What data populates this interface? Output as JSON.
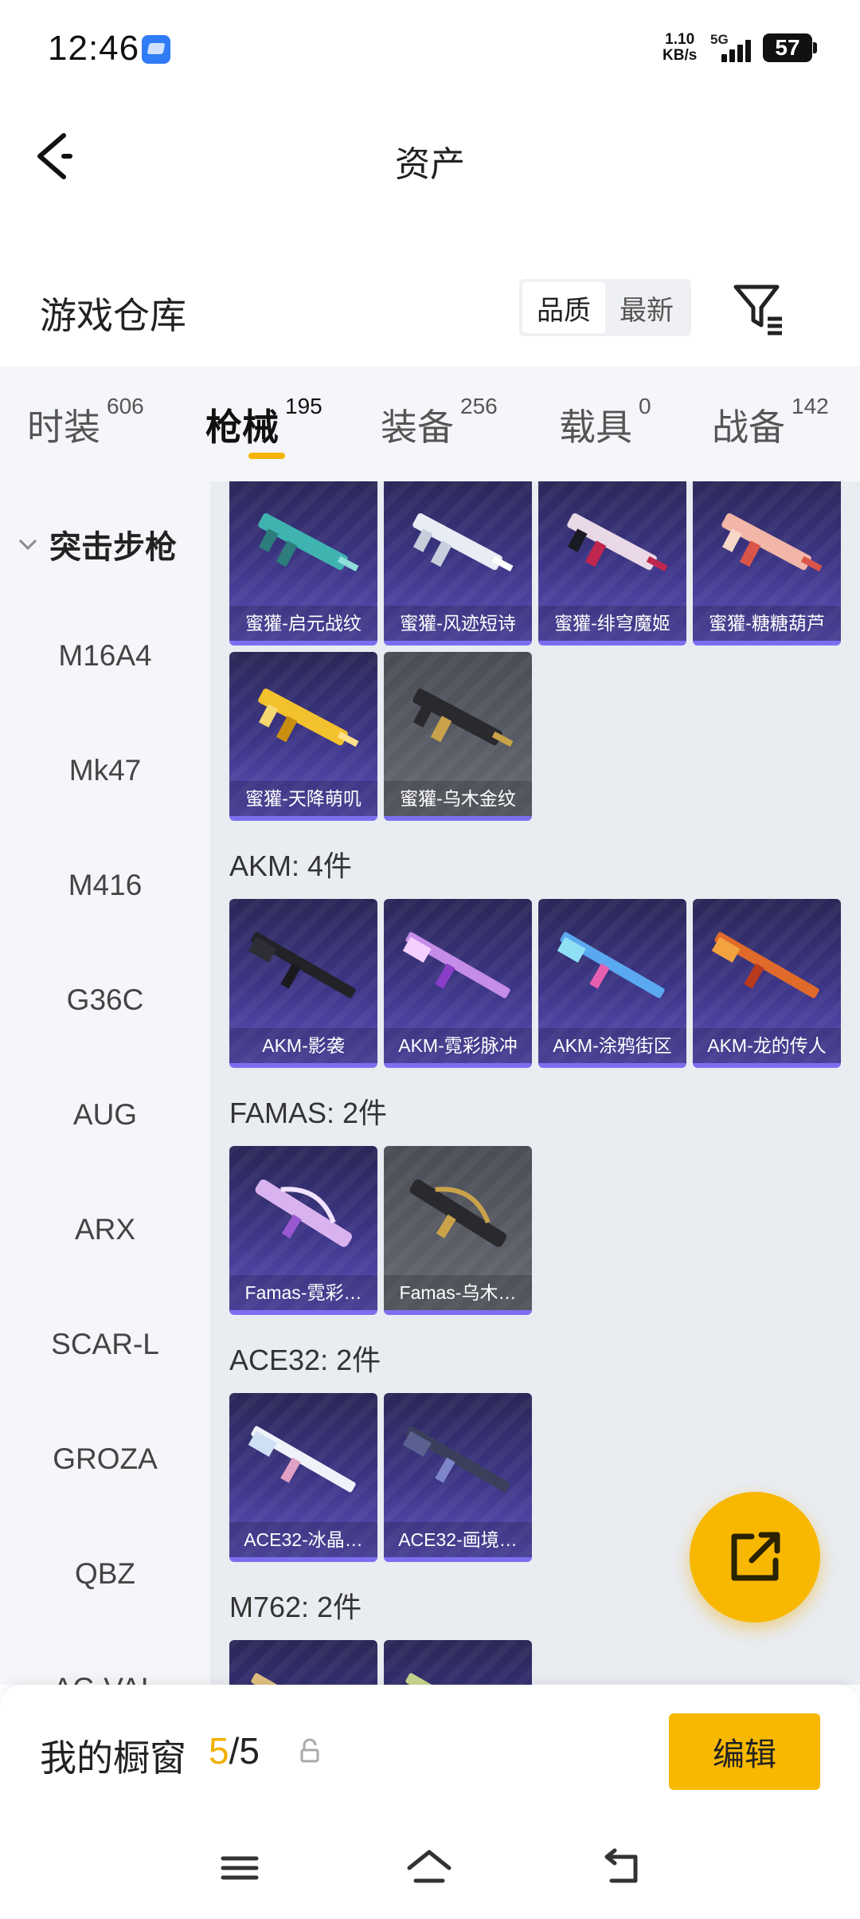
{
  "status": {
    "time": "12:46",
    "net_speed_value": "1.10",
    "net_speed_unit": "KB/s",
    "network": "5G",
    "battery": "57"
  },
  "header": {
    "title": "资产"
  },
  "warehouse": {
    "title": "游戏仓库",
    "sort_options": [
      "品质",
      "最新"
    ],
    "active_sort": "品质"
  },
  "tabs": [
    {
      "label": "时装",
      "count": "606"
    },
    {
      "label": "枪械",
      "count": "195"
    },
    {
      "label": "装备",
      "count": "256"
    },
    {
      "label": "载具",
      "count": "0"
    },
    {
      "label": "战备",
      "count": "142"
    }
  ],
  "sidebar": {
    "category": "突击步枪",
    "items": [
      "M16A4",
      "Mk47",
      "M416",
      "G36C",
      "AUG",
      "ARX",
      "SCAR-L",
      "GROZA",
      "QBZ",
      "AC-VAL"
    ]
  },
  "groups": [
    {
      "label": "",
      "items": [
        "蜜獾-启元战纹",
        "蜜獾-风迹短诗",
        "蜜獾-绯穹魔姬",
        "蜜獾-糖糖葫芦",
        "蜜獾-天降萌叽",
        "蜜獾-乌木金纹"
      ]
    },
    {
      "label": "AKM: 4件",
      "items": [
        "AKM-影袭",
        "AKM-霓彩脉冲",
        "AKM-涂鸦街区",
        "AKM-龙的传人"
      ]
    },
    {
      "label": "FAMAS: 2件",
      "items": [
        "Famas-霓彩…",
        "Famas-乌木…"
      ]
    },
    {
      "label": "ACE32: 2件",
      "items": [
        "ACE32-冰晶…",
        "ACE32-画境…"
      ]
    },
    {
      "label": "M762: 2件",
      "items": []
    }
  ],
  "showcase": {
    "label": "我的橱窗",
    "current": "5",
    "total": "/5",
    "edit_label": "编辑"
  },
  "colors": {
    "accent": "#f8b700",
    "card_purple": "#3e3688",
    "card_gray": "#5a5d66"
  },
  "icons": [
    "back-arrow-icon",
    "filter-icon",
    "share-icon",
    "lock-icon",
    "menu-icon",
    "home-icon",
    "back-icon"
  ]
}
